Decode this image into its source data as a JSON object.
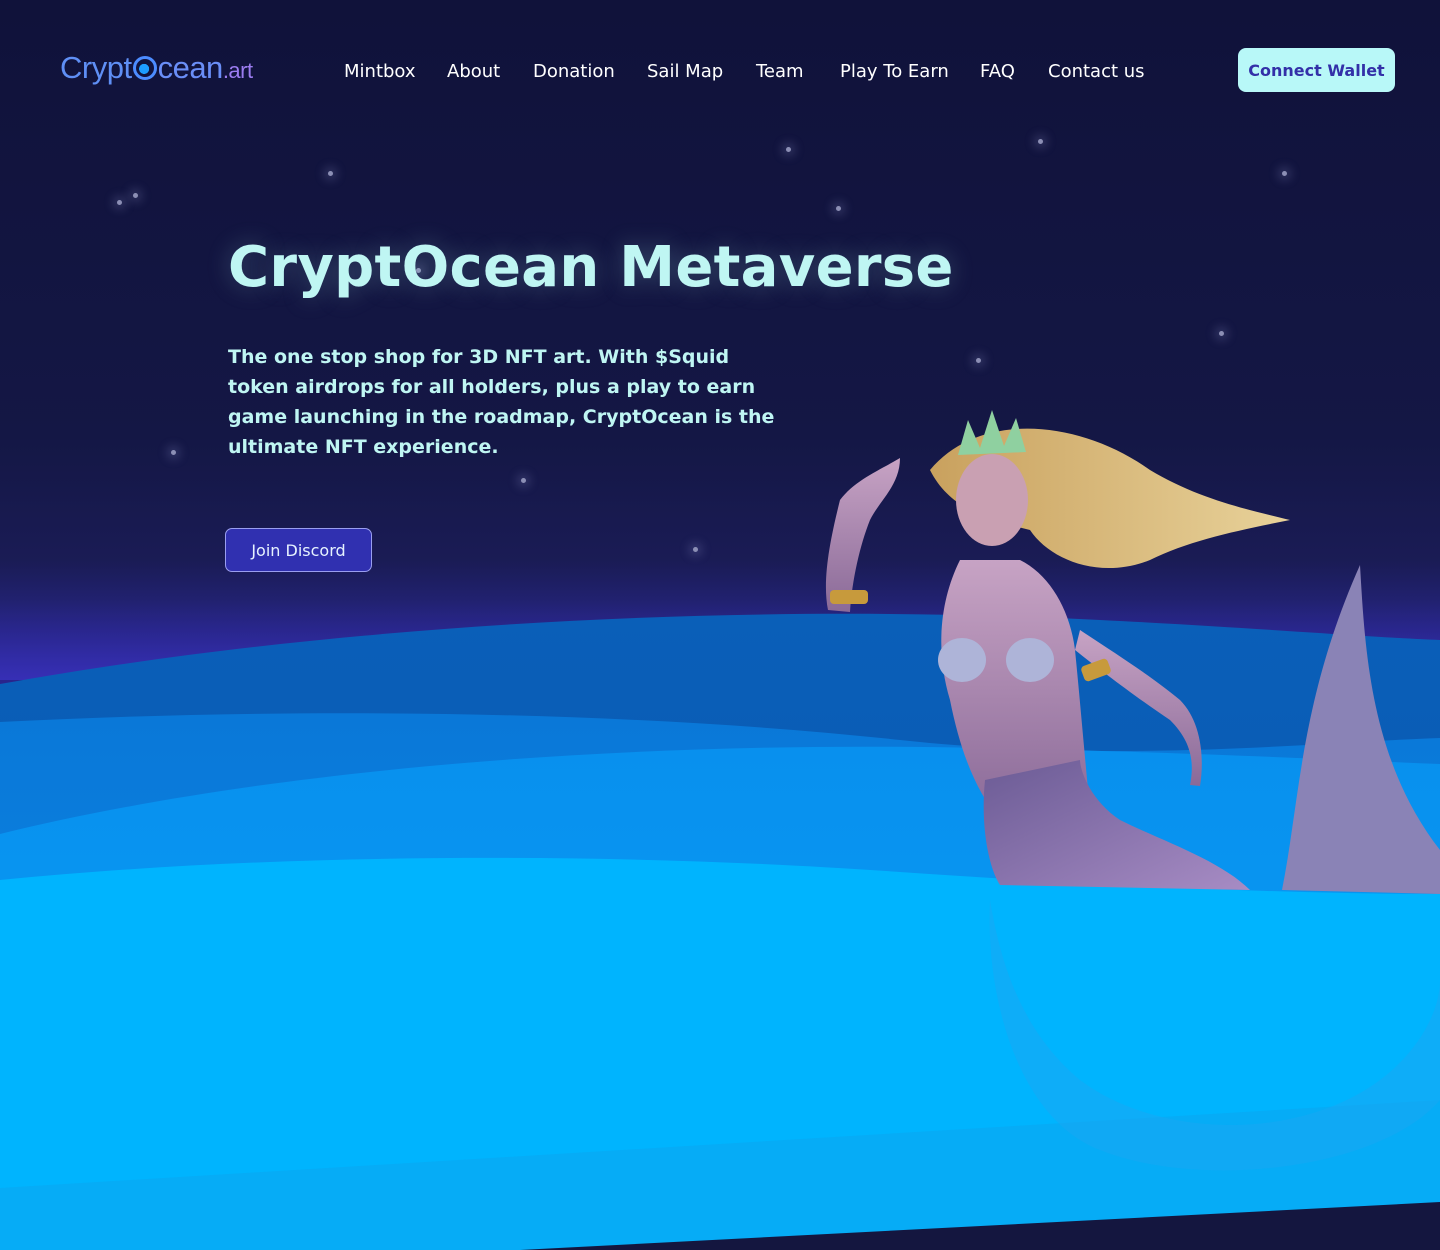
{
  "logo": {
    "part1": "Crypt",
    "part2": "cean",
    "part3": ".art"
  },
  "nav": {
    "items": [
      "Mintbox",
      "About",
      "Donation",
      "Sail Map",
      "Team",
      "Play To Earn",
      "FAQ",
      "Contact us"
    ]
  },
  "header": {
    "connect_label": "Connect Wallet"
  },
  "hero": {
    "title": "CryptOcean Metaverse",
    "description": "The one stop shop for 3D NFT art. With $Squid token airdrops for all holders, plus a play to earn game launching in the roadmap, CryptOcean is the ultimate NFT experience.",
    "cta_label": "Join Discord",
    "illustration": "mermaid-character"
  },
  "colors": {
    "accent": "#b8f8f8",
    "button_primary": "#3030b0",
    "headline": "#bff6f3",
    "background": "#11143a",
    "ocean": "#00b4ff"
  }
}
